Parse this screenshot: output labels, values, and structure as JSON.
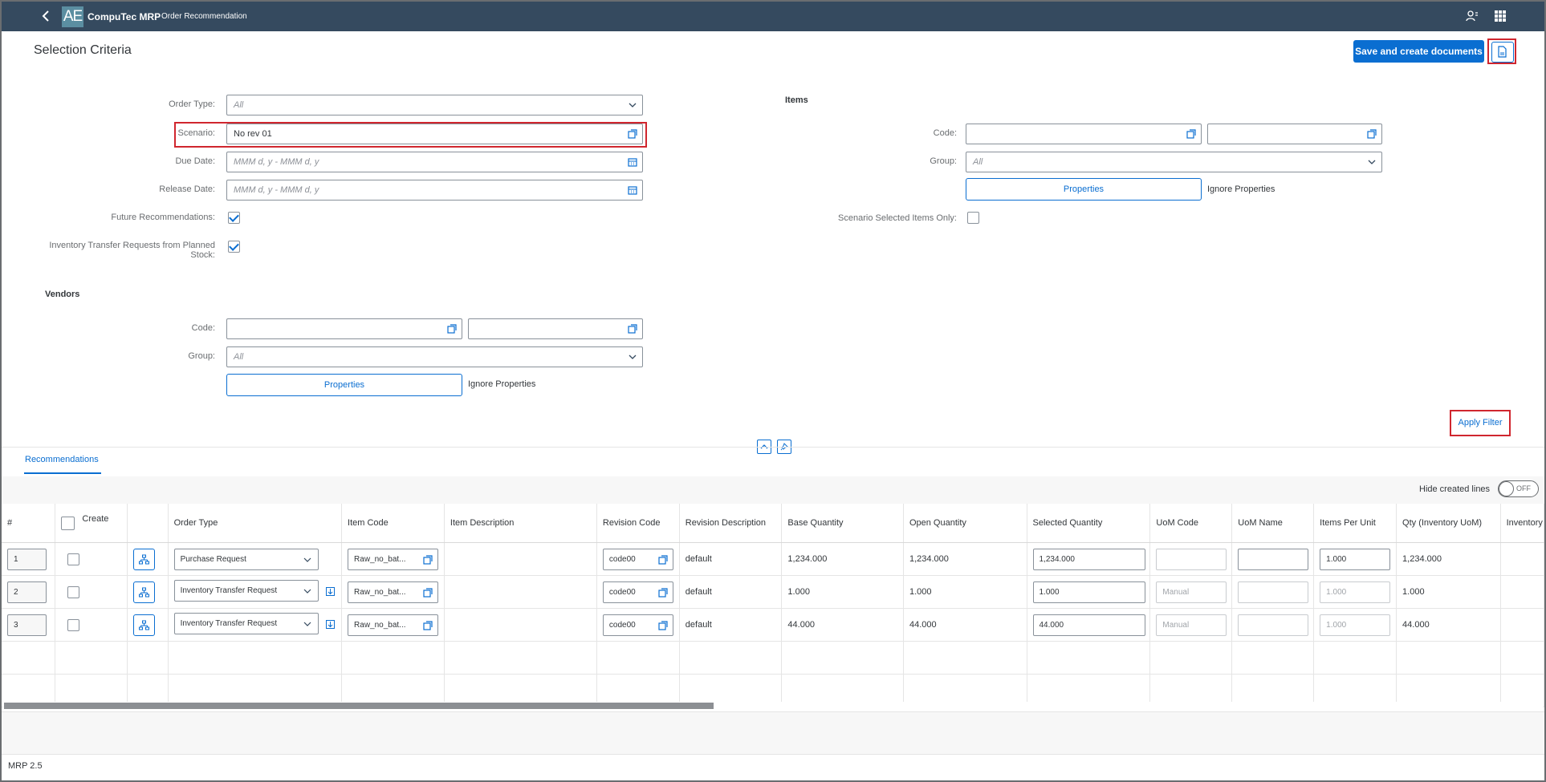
{
  "shell": {
    "logo_text": "AE",
    "app_name": "CompuTec MRP",
    "subtitle": "Order Recommendation"
  },
  "page": {
    "title": "Selection Criteria",
    "save_button": "Save and create documents",
    "apply_filter": "Apply Filter"
  },
  "criteria": {
    "order_type_label": "Order Type:",
    "order_type_value": "All",
    "scenario_label": "Scenario:",
    "scenario_value": "No rev 01",
    "due_date_label": "Due Date:",
    "due_date_placeholder": "MMM d, y - MMM d, y",
    "release_date_label": "Release Date:",
    "release_date_placeholder": "MMM d, y - MMM d, y",
    "future_label": "Future Recommendations:",
    "future_checked": true,
    "itr_label_1": "Inventory Transfer Requests from Planned",
    "itr_label_2": "Stock:",
    "itr_checked": true
  },
  "items": {
    "heading": "Items",
    "code_label": "Code:",
    "group_label": "Group:",
    "group_value": "All",
    "properties_button": "Properties",
    "ignore_properties": "Ignore Properties",
    "scenario_only_label": "Scenario Selected Items Only:"
  },
  "vendors": {
    "heading": "Vendors",
    "code_label": "Code:",
    "group_label": "Group:",
    "group_value": "All",
    "properties_button": "Properties",
    "ignore_properties": "Ignore Properties"
  },
  "tabs": {
    "recommendations": "Recommendations"
  },
  "toolbar": {
    "hide_created_label": "Hide created lines",
    "toggle_state": "OFF"
  },
  "table": {
    "headers": {
      "num": "#",
      "create": "Create",
      "order_type": "Order Type",
      "item_code": "Item Code",
      "item_description": "Item Description",
      "revision_code": "Revision Code",
      "revision_description": "Revision Description",
      "base_quantity": "Base Quantity",
      "open_quantity": "Open Quantity",
      "selected_quantity": "Selected Quantity",
      "uom_code": "UoM Code",
      "uom_name": "UoM Name",
      "items_per_unit": "Items Per Unit",
      "qty_inventory_uom": "Qty (Inventory UoM)",
      "inventory": "Inventory"
    },
    "rows": [
      {
        "num": "1",
        "order_type": "Purchase Request",
        "item_code": "Raw_no_bat...",
        "revision_code": "code00",
        "revision_description": "default",
        "base_quantity": "1,234.000",
        "open_quantity": "1,234.000",
        "selected_quantity": "1,234.000",
        "uom_code": "",
        "uom_name": "",
        "items_per_unit": "1.000",
        "qty_inventory_uom": "1,234.000"
      },
      {
        "num": "2",
        "order_type": "Inventory Transfer Request",
        "item_code": "Raw_no_bat...",
        "revision_code": "code00",
        "revision_description": "default",
        "base_quantity": "1.000",
        "open_quantity": "1.000",
        "selected_quantity": "1.000",
        "uom_code": "Manual",
        "uom_name": "",
        "items_per_unit": "1.000",
        "qty_inventory_uom": "1.000"
      },
      {
        "num": "3",
        "order_type": "Inventory Transfer Request",
        "item_code": "Raw_no_bat...",
        "revision_code": "code00",
        "revision_description": "default",
        "base_quantity": "44.000",
        "open_quantity": "44.000",
        "selected_quantity": "44.000",
        "uom_code": "Manual",
        "uom_name": "",
        "items_per_unit": "1.000",
        "qty_inventory_uom": "44.000"
      }
    ]
  },
  "footer": {
    "version": "MRP 2.5"
  },
  "colors": {
    "shell": "#354a5f",
    "accent": "#0a6ed1",
    "highlight": "#d0262e"
  }
}
